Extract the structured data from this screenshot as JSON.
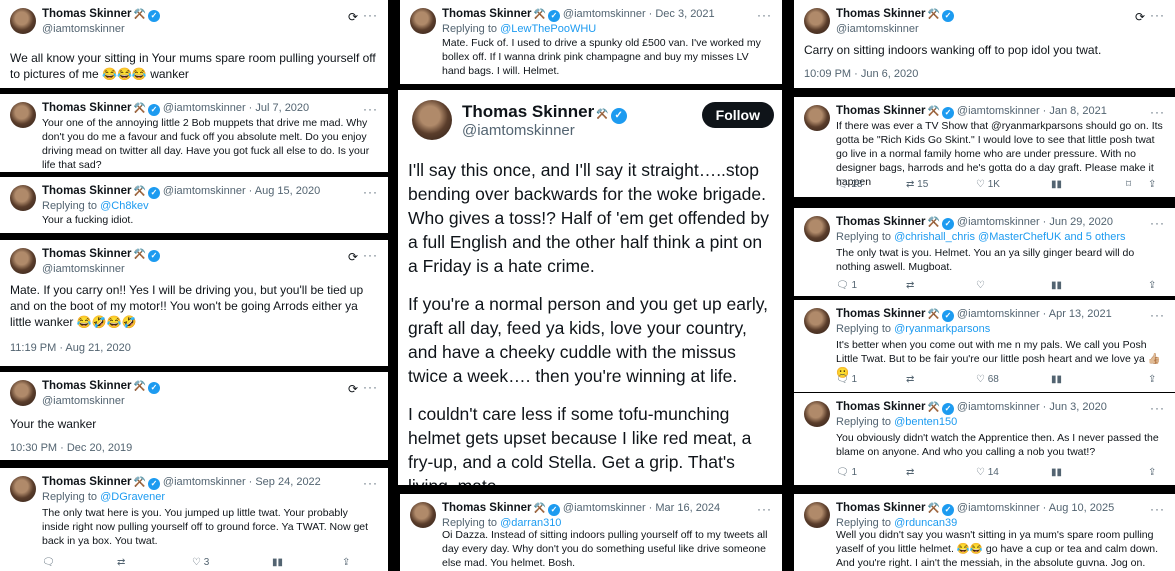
{
  "colors": {
    "accent": "#1d9bf0",
    "background": "#000000",
    "card": "#ffffff",
    "muted": "#536471"
  },
  "author": {
    "name": "Thomas Skinner",
    "emoji": "⚒️",
    "handle": "@iamtomskinner"
  },
  "follow_label": "Follow",
  "tweets": [
    {
      "id": "t1",
      "text": "We all know your sitting in Your mums spare room pulling yourself off to pictures of me 😂😂😂 wanker"
    },
    {
      "id": "t2",
      "date": "· Jul 7, 2020",
      "text": "Your one of the annoying little 2 Bob muppets that drive me mad. Why don't you do me a favour and fuck off you absolute melt. Do you enjoy driving mead on twitter all day. Have you got fuck all else to do. Is your life that sad?"
    },
    {
      "id": "t3",
      "date": "· Aug 15, 2020",
      "reply_prefix": "Replying to",
      "reply_to": "@Ch8kev",
      "text": "Your a fucking idiot."
    },
    {
      "id": "t4",
      "text": "Mate. If you carry on!! Yes I will be driving you, but you'll be tied up and on the boot of my motor!! You won't be going Arrods either ya little wanker 😂🤣😂🤣",
      "time": "11:19 PM · Aug 21, 2020"
    },
    {
      "id": "t5",
      "text": "Your the wanker",
      "time": "10:30 PM · Dec 20, 2019"
    },
    {
      "id": "t6",
      "date": "· Sep 24, 2022",
      "reply_prefix": "Replying to",
      "reply_to": "@DGravener",
      "text": "The only twat here is you. You jumped up little twat. Your probably inside right now pulling yourself off to ground force. Ya TWAT. Now get back in ya box. You twat.",
      "likes": "3"
    },
    {
      "id": "t7",
      "date": "· Dec 3, 2021",
      "reply_prefix": "Replying to",
      "reply_to": "@LewThePooWHU",
      "text": "Mate. Fuck of. I used to drive a spunky old £500 van. I've worked my bollex off. If I wanna drink pink champagne and buy my misses LV hand bags. I will. Helmet."
    },
    {
      "id": "t8",
      "text": "I'll say this once, and I'll say it straight…..stop bending over backwards for the woke brigade. Who gives a toss!? Half of 'em get offended by a full English and the other half think a pint on a Friday is a hate crime.",
      "text2": "If you're a normal person and you get up early, graft all day, feed ya kids, love your country, and have a cheeky cuddle with the missus twice a week…. then you're winning at life.",
      "text3": "I couldn't care less if some tofu-munching helmet gets upset because I like red meat, a fry-up, and a cold Stella. Get a grip. That's living, mate."
    },
    {
      "id": "t9",
      "date": "· Mar 16, 2024",
      "reply_prefix": "Replying to",
      "reply_to": "@darran310",
      "text": "Oi Dazza. Instead of sitting indoors pulling yourself off to my tweets all day every day. Why don't you do something useful like drive someone else mad. You helmet. Bosh."
    },
    {
      "id": "t10",
      "text": "Carry on sitting indoors wanking off to pop idol you twat.",
      "time": "10:09 PM · Jun 6, 2020"
    },
    {
      "id": "t11",
      "date": "· Jan 8, 2021",
      "text": "If there was ever a TV Show that @ryanmarkparsons should go on. Its gotta be \"Rich Kids Go Skint.\" I would love to see that little posh twat go live in a normal family home who are under pressure. With no designer bags, harrods and he's gotta do a day graft. Please make it happen",
      "replies": "28",
      "retweets": "15",
      "likes": "1K"
    },
    {
      "id": "t12",
      "date": "· Jun 29, 2020",
      "reply_prefix": "Replying to",
      "reply_to": "@chrishall_chris @MasterChefUK and 5 others",
      "text": "The only twat is you. Helmet. You an ya silly ginger beard will do nothing aswell. Mugboat.",
      "replies": "1"
    },
    {
      "id": "t13",
      "date": "· Apr 13, 2021",
      "reply_prefix": "Replying to",
      "reply_to": "@ryanmarkparsons",
      "text": "It's better when you come out with me n my pals. We call you Posh Little Twat. But to be fair you're our little posh heart and we love ya 👍🏼🙂",
      "replies": "1",
      "likes": "68"
    },
    {
      "id": "t14",
      "date": "· Jun 3, 2020",
      "reply_prefix": "Replying to",
      "reply_to": "@benten150",
      "text": "You obviously didn't watch the Apprentice then. As I never passed the blame on anyone. And who you calling a nob you twat!?",
      "replies": "1",
      "likes": "14"
    },
    {
      "id": "t15",
      "date": "· Aug 10, 2025",
      "reply_prefix": "Replying to",
      "reply_to": "@rduncan39",
      "text": "Well you didn't say you wasn't sitting in ya mum's spare room pulling yaself of you little helmet. 😂😂 go have a cup or tea and calm down. And you're right. I ain't the messiah, in the absolute guvna. Jog on. Bosh"
    }
  ],
  "icons": {
    "logo": "x-logo-icon",
    "more": "more-icon",
    "reply": "reply-icon",
    "retweet": "retweet-icon",
    "like": "heart-icon",
    "views": "views-icon",
    "bookmark": "bookmark-icon",
    "share": "share-icon",
    "verified": "verified-badge-icon"
  }
}
